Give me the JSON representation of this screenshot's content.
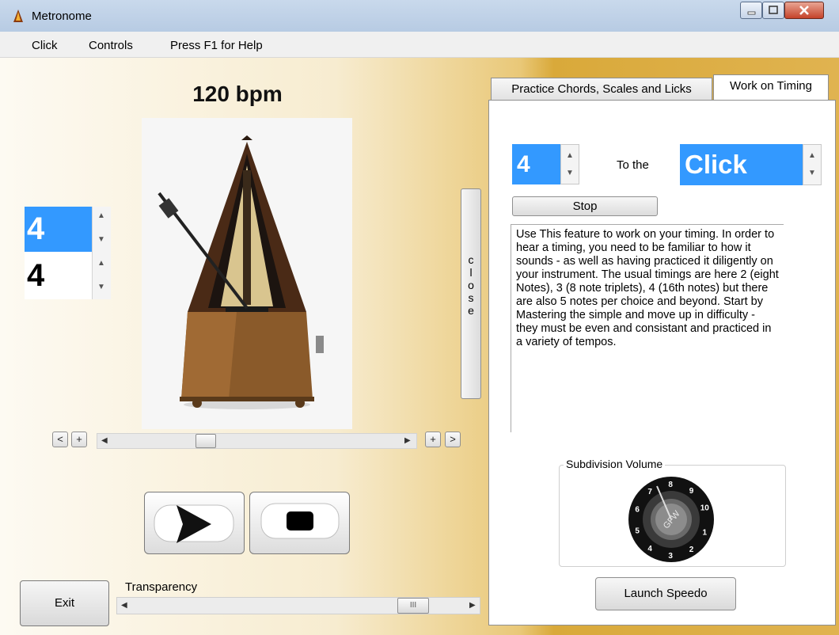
{
  "window": {
    "title": "Metronome"
  },
  "menu": [
    {
      "label": "Click"
    },
    {
      "label": "Controls"
    },
    {
      "label": "Press F1 for Help"
    }
  ],
  "tempo": {
    "bpm_label": "120 bpm",
    "slider_level": 0.32
  },
  "time_signature": {
    "numerator": "4",
    "denominator": "4"
  },
  "side_panel": {
    "close_label": "c\nl\no\ns\ne"
  },
  "tempo_buttons": {
    "decrease": "<",
    "plus_left": "+",
    "plus_right": "+",
    "increase": ">"
  },
  "transport": {
    "play_icon": "play-icon",
    "stop_icon": "stop-icon"
  },
  "footer": {
    "exit_label": "Exit",
    "transparency_label": "Transparency",
    "transparency_level": 0.88,
    "thumb_glyph": "III"
  },
  "tabs": [
    {
      "label": "Practice Chords, Scales and Licks",
      "active": false
    },
    {
      "label": "Work on Timing",
      "active": true
    }
  ],
  "timing": {
    "division": "4",
    "to_the_label": "To the",
    "target": "Click",
    "stop_label": "Stop",
    "description": "Use This feature to work on your timing.  In order to hear a timing, you need to be familiar to how it sounds - as well as having practiced it diligently on your instrument.  The usual timings are here 2 (eight Notes), 3 (8 note triplets), 4 (16th notes) but there are also 5 notes per choice and beyond.  Start by Mastering the simple and move up in difficulty - they must be even and consistant and practiced in a variety of tempos.",
    "subdivision_label": "Subdivision Volume",
    "knob_center": "GFW",
    "knob_numbers": [
      "1",
      "2",
      "3",
      "4",
      "5",
      "6",
      "7",
      "8",
      "9",
      "10"
    ],
    "launch_label": "Launch Speedo"
  },
  "colors": {
    "accent": "#3399ff",
    "gold": "#d9a93a"
  }
}
